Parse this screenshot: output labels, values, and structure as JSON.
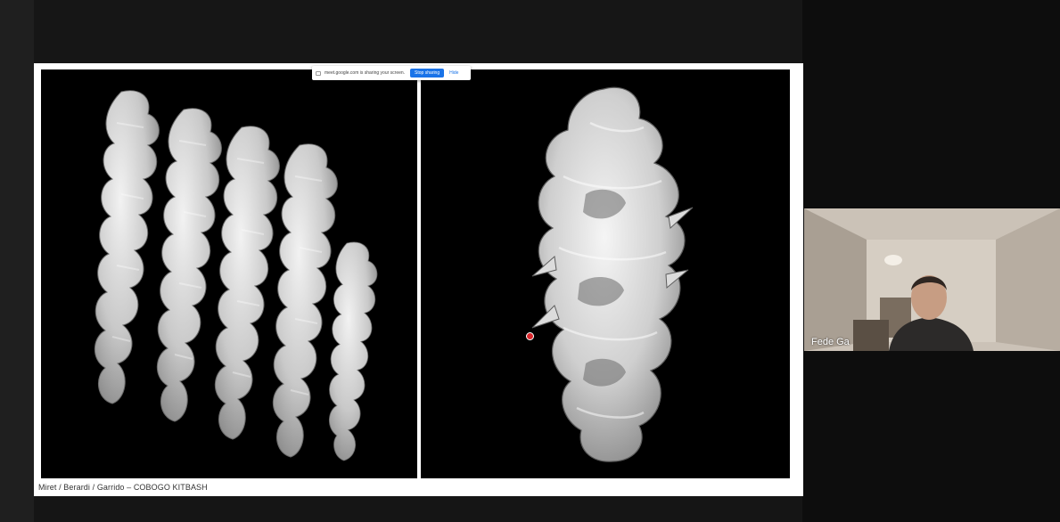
{
  "screen_share": {
    "notice_text": "meet.google.com is sharing your screen.",
    "stop_button_label": "Stop sharing",
    "hide_label": "Hide"
  },
  "slide": {
    "caption": "Miret / Berardi / Garrido – COBOGO KITBASH"
  },
  "participant": {
    "name": "Fede Ga"
  },
  "icons": {
    "share_icon": "screen-share-icon",
    "pointer": "laser-pointer-icon"
  },
  "colors": {
    "stop_button": "#1a73e8",
    "pointer": "#d9262b",
    "background": "#161616"
  }
}
